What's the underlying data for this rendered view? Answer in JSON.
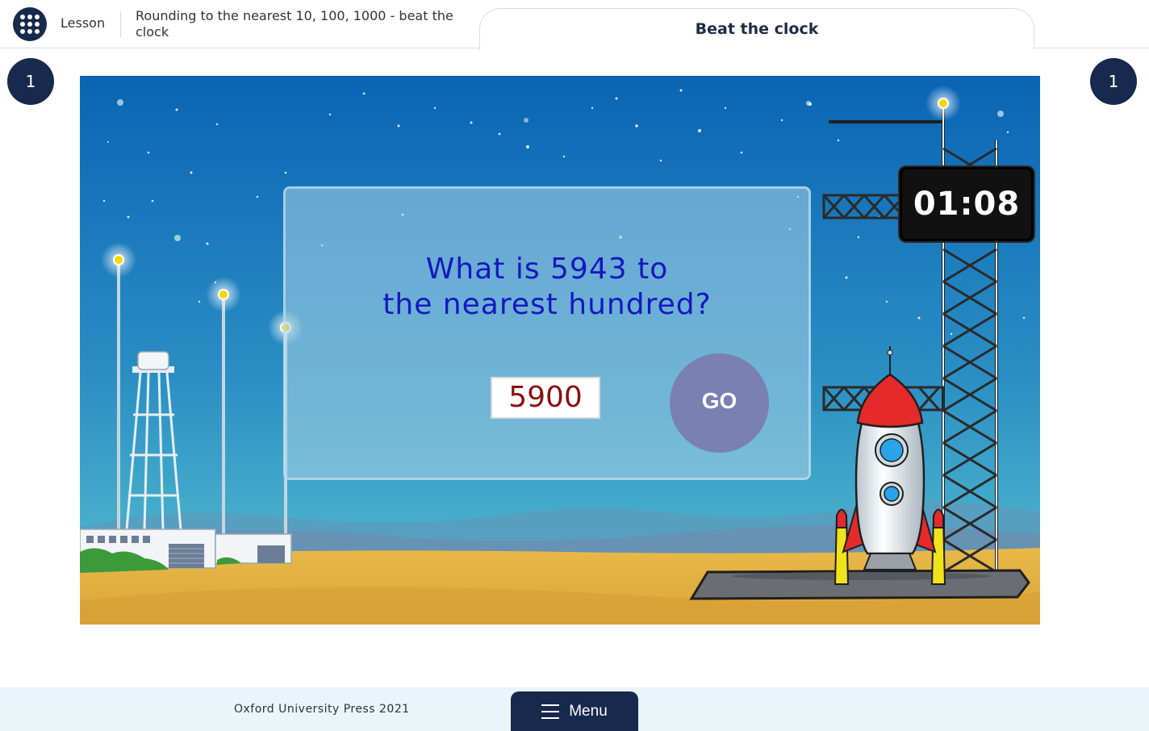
{
  "header": {
    "section_label": "Lesson",
    "lesson_title": "Rounding to the nearest 10, 100, 1000 - beat the clock",
    "tab_title": "Beat the clock"
  },
  "counters": {
    "left": "1",
    "right": "1"
  },
  "game": {
    "question_line1": "What is 5943 to",
    "question_line2": "the nearest hundred?",
    "answer_value": "5900",
    "go_label": "GO",
    "timer": "01:08"
  },
  "footer": {
    "copyright": "Oxford University Press 2021",
    "menu_label": "Menu"
  },
  "colors": {
    "navy": "#17294d",
    "question_text": "#1418c0",
    "answer_text": "#8a1010",
    "go_button": "#7a80b2"
  }
}
